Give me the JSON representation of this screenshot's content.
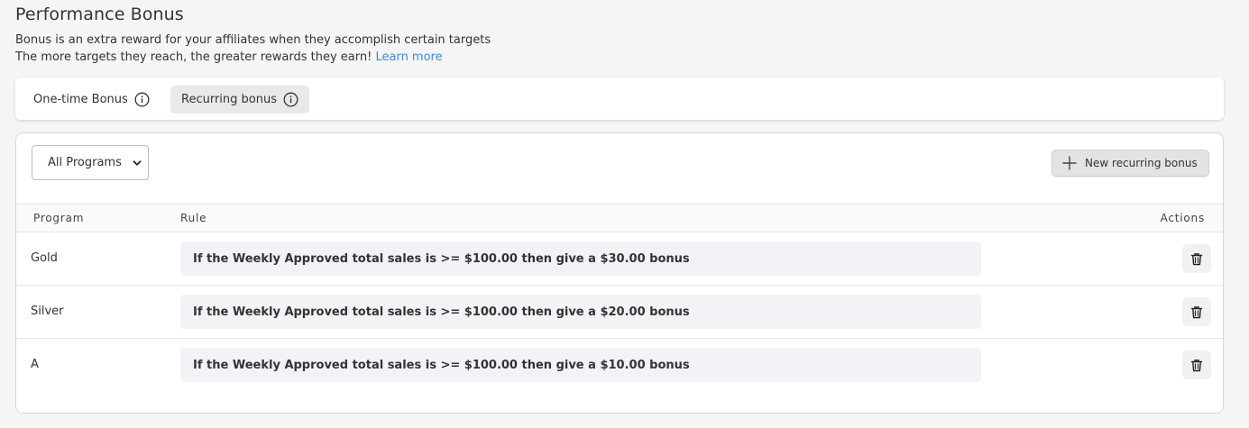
{
  "header": {
    "title": "Performance Bonus",
    "description_line1": "Bonus is an extra reward for your affiliates when they accomplish certain targets",
    "description_line2": "The more targets they reach, the greater rewards they earn!",
    "learn_more": "Learn more"
  },
  "tabs": [
    {
      "label": "One-time Bonus",
      "icon": "info-icon",
      "active": false
    },
    {
      "label": "Recurring bonus",
      "icon": "info-icon",
      "active": true
    }
  ],
  "toolbar": {
    "program_filter": "All Programs",
    "new_button": "New recurring bonus"
  },
  "table": {
    "columns": [
      "Program",
      "Rule",
      "Actions"
    ],
    "rows": [
      {
        "program": "Gold",
        "rule": "If the Weekly Approved total sales is >= $100.00 then give a $30.00 bonus"
      },
      {
        "program": "Silver",
        "rule": "If the Weekly Approved total sales is >= $100.00 then give a $20.00 bonus"
      },
      {
        "program": "A",
        "rule": "If the Weekly Approved total sales is >= $100.00 then give a $10.00 bonus"
      }
    ]
  },
  "colors": {
    "link": "#3a8de0",
    "rule_bg": "#f1f3f6",
    "active_tab_bg": "#e9e9e9"
  }
}
